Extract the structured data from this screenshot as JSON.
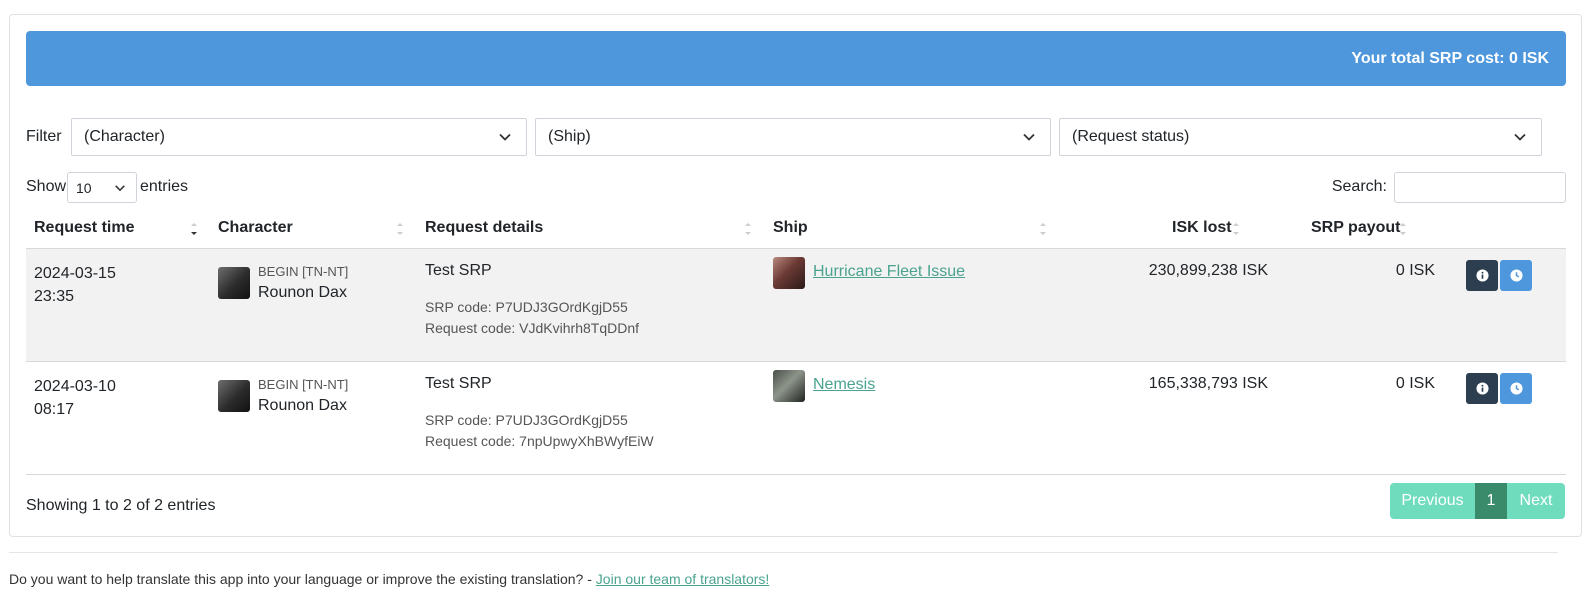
{
  "summary": {
    "total_text": "Your total SRP cost: 0 ISK"
  },
  "filters": {
    "label": "Filter",
    "character": "(Character)",
    "ship": "(Ship)",
    "status": "(Request status)"
  },
  "table_controls": {
    "show_label": "Show",
    "entries_value": "10",
    "entries_label": "entries",
    "search_label": "Search:"
  },
  "columns": [
    "Request time",
    "Character",
    "Request details",
    "Ship",
    "ISK lost",
    "SRP payout"
  ],
  "rows": [
    {
      "date": "2024-03-15",
      "time": "23:35",
      "corp": "BEGIN [TN-NT]",
      "character": "Rounon Dax",
      "title": "Test SRP",
      "srp_code": "SRP code: P7UDJ3GOrdKgjD55",
      "request_code": "Request code: VJdKvihrh8TqDDnf",
      "ship": "Hurricane Fleet Issue",
      "isk_lost": "230,899,238 ISK",
      "payout": "0 ISK"
    },
    {
      "date": "2024-03-10",
      "time": "08:17",
      "corp": "BEGIN [TN-NT]",
      "character": "Rounon Dax",
      "title": "Test SRP",
      "srp_code": "SRP code: P7UDJ3GOrdKgjD55",
      "request_code": "Request code: 7npUpwyXhBWyfEiW",
      "ship": "Nemesis",
      "isk_lost": "165,338,793 ISK",
      "payout": "0 ISK"
    }
  ],
  "footer": {
    "info": "Showing 1 to 2 of 2 entries",
    "previous": "Previous",
    "page": "1",
    "next": "Next"
  },
  "translate_note": {
    "text": "Do you want to help translate this app into your language or improve the existing translation? - ",
    "link": "Join our team of translators!"
  },
  "colors": {
    "accent_blue": "#4f97dc",
    "dark_button": "#2c3e50",
    "link_green": "#4aa38f",
    "pager_green": "#6fdcbd"
  }
}
